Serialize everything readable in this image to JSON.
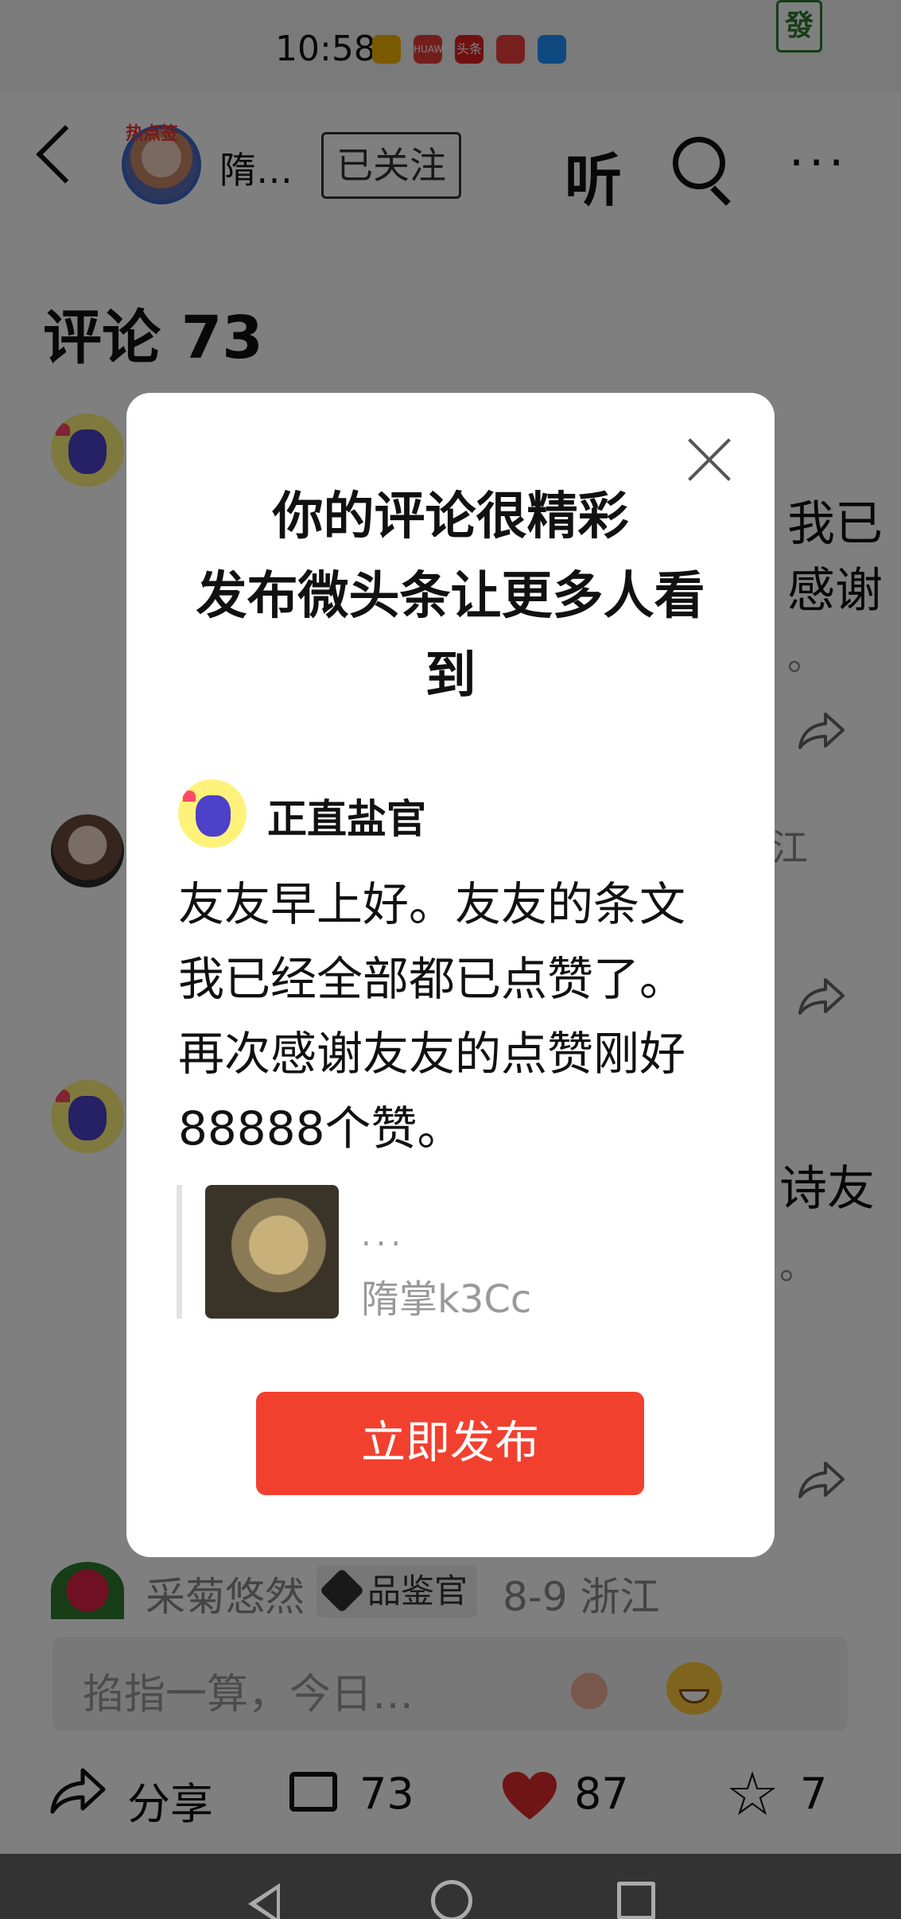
{
  "status_bar": {
    "time": "10:58",
    "app_icons": [
      {
        "name": "weibo-icon",
        "color": "#f5b400"
      },
      {
        "name": "huawei-icon",
        "label": "HUAWEI",
        "color": "#e83a3a"
      },
      {
        "name": "toutiao-icon",
        "label": "头条",
        "color": "#e02020"
      },
      {
        "name": "red-app-icon",
        "color": "#f04040"
      },
      {
        "name": "browser-icon",
        "color": "#1e90ff"
      }
    ]
  },
  "header": {
    "user_name": "隋…",
    "hot_badge": "热点签",
    "follow_label": "已关注",
    "listen_label": "听"
  },
  "comments": {
    "title": "评论 73",
    "fragments": {
      "c1_line1": "我已",
      "c1_line2": "感谢",
      "c1_line3": "。",
      "c2_region": "江",
      "c3_line1": "诗友",
      "c3_line2": "。"
    },
    "last_comment": {
      "user": "采菊悠然",
      "badge": "品鉴官",
      "date_location": "8-9  浙江"
    }
  },
  "input": {
    "placeholder": "掐指一算，今日…"
  },
  "actions": {
    "share_label": "分享",
    "comments_count": "73",
    "likes_count": "87",
    "favorites_count": "7"
  },
  "modal": {
    "title_lines": [
      "你的评论很精彩",
      "发布微头条让更多人看",
      "到"
    ],
    "author": "正直盐官",
    "body": "友友早上好。友友的条文我已经全部都已点赞了。再次感谢友友的点赞刚好88888个赞。",
    "quote": {
      "dots": "...",
      "author": "隋掌k3Cc"
    },
    "publish_label": "立即发布"
  },
  "colors": {
    "publish": "#f2402f",
    "like_heart": "#e02b2b",
    "overlay": "rgba(0,0,0,0.5)"
  }
}
